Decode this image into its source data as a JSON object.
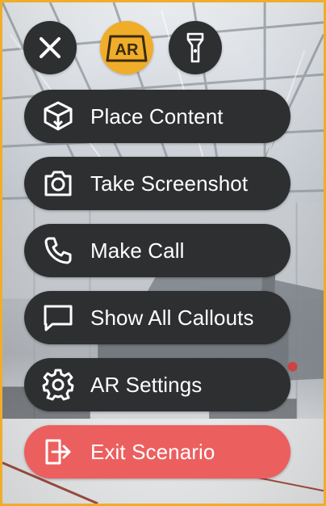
{
  "top_controls": {
    "close": {
      "icon": "close-icon"
    },
    "ar": {
      "label": "AR",
      "icon": "ar-mode-icon"
    },
    "flashlight": {
      "icon": "flashlight-icon"
    }
  },
  "menu": {
    "items": [
      {
        "label": "Place Content",
        "icon": "place-content-icon"
      },
      {
        "label": "Take Screenshot",
        "icon": "camera-icon"
      },
      {
        "label": "Make Call",
        "icon": "phone-icon"
      },
      {
        "label": "Show All Callouts",
        "icon": "callout-icon"
      },
      {
        "label": "AR Settings",
        "icon": "gear-icon"
      },
      {
        "label": "Exit Scenario",
        "icon": "exit-icon"
      }
    ]
  },
  "colors": {
    "frame_border": "#f0ad2a",
    "accent": "#f0ad2a",
    "pill_background": "#2d2f31",
    "exit_background": "#ec5f5f",
    "label_text": "#ffffff"
  }
}
